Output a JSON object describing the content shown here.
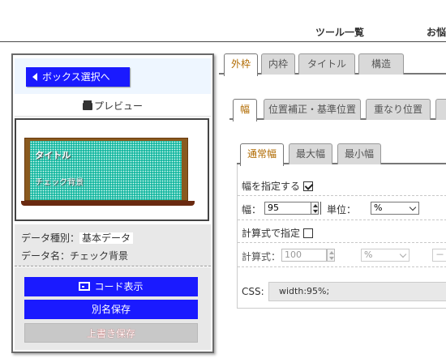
{
  "header": {
    "nav": [
      "ツール一覧",
      "お悩"
    ]
  },
  "left": {
    "back_label": "ボックス選択へ",
    "preview_label": "プレビュー",
    "preview": {
      "title": "タイトル",
      "text": "チェック背景"
    },
    "info": {
      "type_label": "データ種別：",
      "type_value": "基本データ",
      "name_label": "データ名：チェック背景"
    },
    "buttons": {
      "code": "コード表示",
      "alias_save": "別名保存",
      "overwrite": "上書き保存"
    }
  },
  "tabs1": [
    "外枠",
    "内枠",
    "タイトル",
    "構造"
  ],
  "tabs2": [
    "幅",
    "位置補正・基準位置",
    "重なり位置"
  ],
  "tabs3": [
    "通常幅",
    "最大幅",
    "最小幅"
  ],
  "form": {
    "set_width_label": "幅を指定する",
    "set_width_checked": true,
    "width_label": "幅：",
    "width_value": "95",
    "unit_label": "単位：",
    "unit_value": "%",
    "calc_label": "計算式で指定",
    "calc_checked": false,
    "formula_label": "計算式：",
    "formula_value": "100",
    "formula_unit": "%",
    "formula_op": "－",
    "css_label": "CSS:",
    "css_value": "width:95%;"
  },
  "colors": {
    "primary_button": "#1a1aff",
    "active_tab_text": "#b06a00",
    "board_frame": "#8a5a1f",
    "board_fill": "#1ab8a2"
  }
}
